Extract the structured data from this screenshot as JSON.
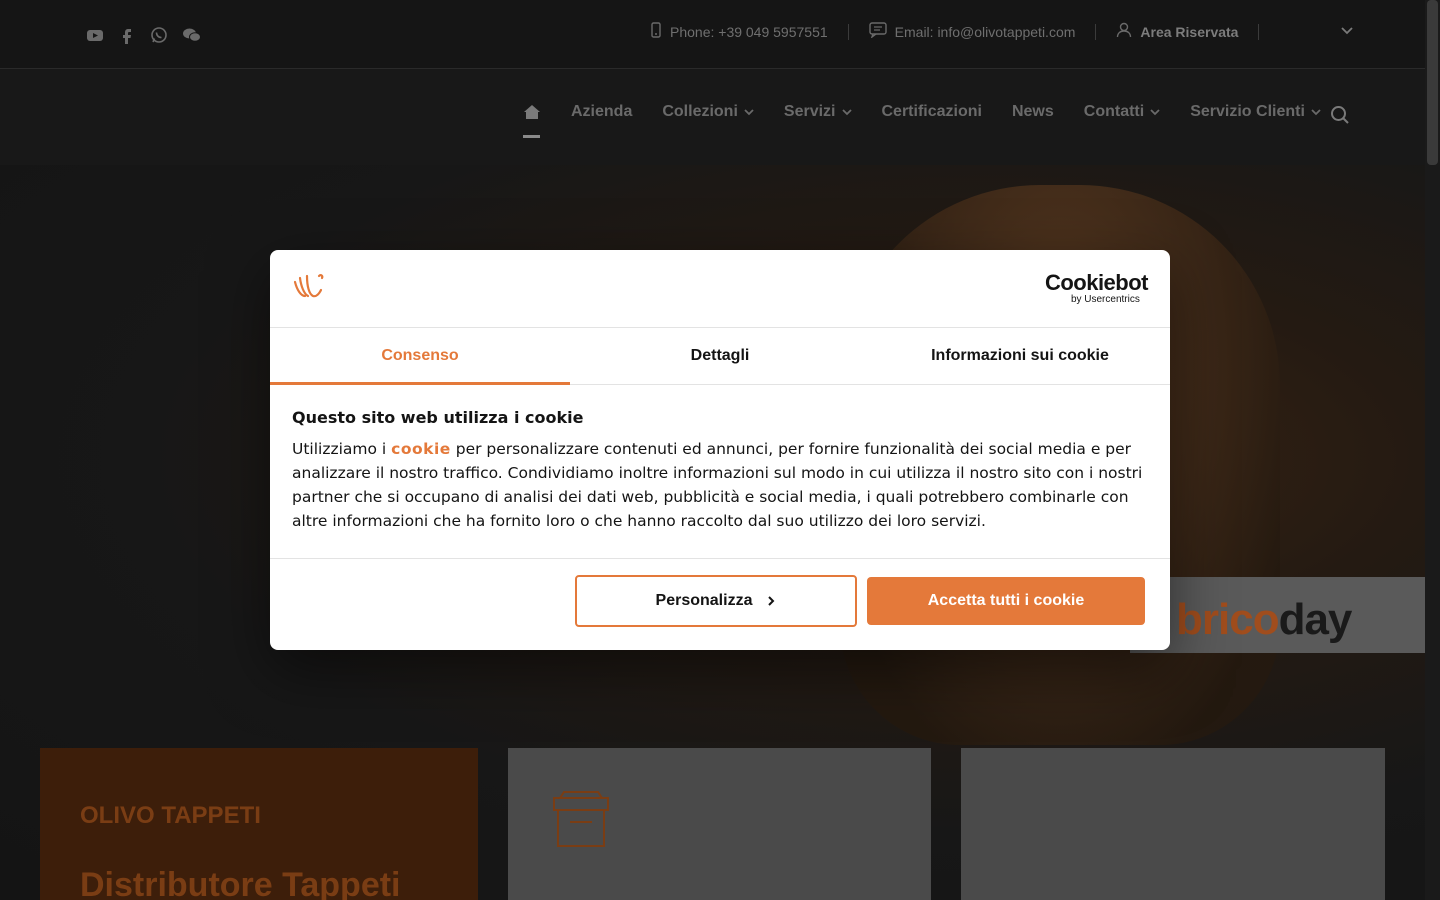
{
  "colors": {
    "accent": "#e4793a",
    "page_bg": "#141414",
    "dialog_bg": "#ffffff"
  },
  "topbar": {
    "social_icons": [
      "youtube-icon",
      "facebook-icon",
      "whatsapp-icon",
      "wechat-icon"
    ],
    "phone_label": "Phone: +39 049 5957551",
    "email_label": "Email: info@olivotappeti.com",
    "area_label": "Area Riservata"
  },
  "nav": {
    "items": [
      {
        "label": "Azienda"
      },
      {
        "label": "Collezioni"
      },
      {
        "label": "Servizi"
      },
      {
        "label": "Certificazioni"
      },
      {
        "label": "News"
      },
      {
        "label": "Contatti"
      },
      {
        "label": "Servizio Clienti"
      }
    ]
  },
  "hero": {
    "brand_text_a": "brico",
    "brand_text_b": "day"
  },
  "cards": {
    "brand": "OLIVO TAPPETI",
    "title": "Distributore Tappeti"
  },
  "cookie_dialog": {
    "brand_name": "Cookiebot",
    "brand_sub": "by Usercentrics",
    "tabs": [
      {
        "label": "Consenso"
      },
      {
        "label": "Dettagli"
      },
      {
        "label": "Informazioni sui cookie"
      }
    ],
    "heading": "Questo sito web utilizza i cookie",
    "text_before": "Utilizziamo i ",
    "link_text": "cookie",
    "text_after": " per personalizzare contenuti ed annunci, per fornire funzionalità dei social media e per analizzare il nostro traffico. Condividiamo inoltre informazioni sul modo in cui utilizza il nostro sito con i nostri partner che si occupano di analisi dei dati web, pubblicità e social media, i quali potrebbero combinarle con altre informazioni che ha fornito loro o che hanno raccolto dal suo utilizzo dei loro servizi.",
    "customize_label": "Personalizza",
    "accept_label": "Accetta tutti i cookie"
  }
}
